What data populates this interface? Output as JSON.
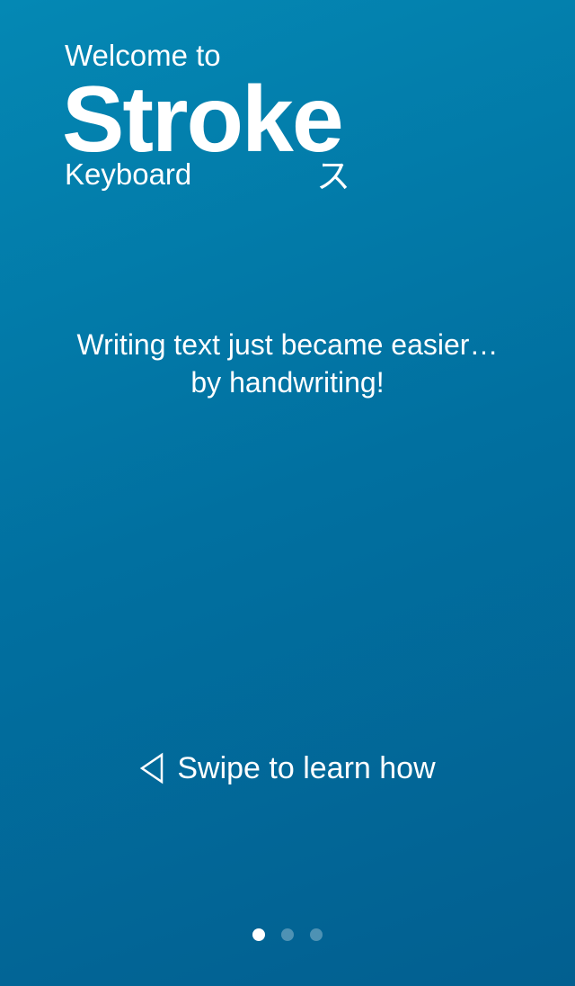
{
  "logo": {
    "welcome": "Welcome to",
    "brand": "Stroke",
    "subtitle": "Keyboard",
    "kana": "ス"
  },
  "tagline": {
    "line1": "Writing text just became easier…",
    "line2": "by handwriting!"
  },
  "swipe": {
    "icon": "left-triangle-outline-icon",
    "label": "Swipe to learn how"
  },
  "pager": {
    "total": 3,
    "active": 0
  },
  "colors": {
    "background_top": "#0488b4",
    "background_bottom": "#025f90",
    "text": "#ffffff"
  }
}
